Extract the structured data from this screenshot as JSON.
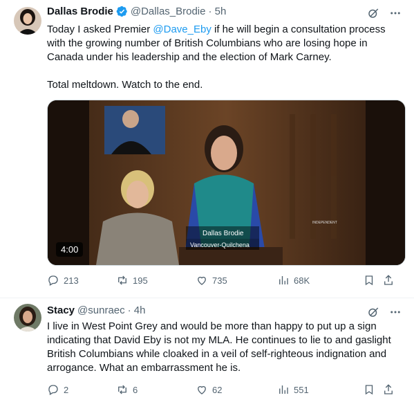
{
  "tweet1": {
    "display_name": "Dallas Brodie",
    "handle": "@Dallas_Brodie",
    "time": "· 5h",
    "text_pre": "Today I asked Premier ",
    "mention": "@Dave_Eby",
    "text_post": " if he will begin a consultation process with  the growing number of British Columbians who are losing hope in Canada under his leadership and the election of Mark Carney.",
    "text_2": "Total meltdown. Watch to the end.",
    "video": {
      "duration": "4:00",
      "caption_name": "Dallas Brodie",
      "caption_riding": "Vancouver-Quilchena",
      "badge": "INDEPENDENT"
    },
    "stats": {
      "replies": "213",
      "reposts": "195",
      "likes": "735",
      "views": "68K"
    }
  },
  "tweet2": {
    "display_name": "Stacy",
    "handle": "@sunraec",
    "time": "· 4h",
    "text": "I live in West Point Grey and would be more than happy to put up a sign indicating that David Eby is not my MLA.  He continues to lie to and gaslight British Columbians while cloaked in a veil of self-righteous indignation and arrogance.  What an embarrassment he is.",
    "stats": {
      "replies": "2",
      "reposts": "6",
      "likes": "62",
      "views": "551"
    }
  },
  "colors": {
    "accent": "#1d9bf0",
    "muted": "#536471",
    "text": "#0f1419"
  }
}
